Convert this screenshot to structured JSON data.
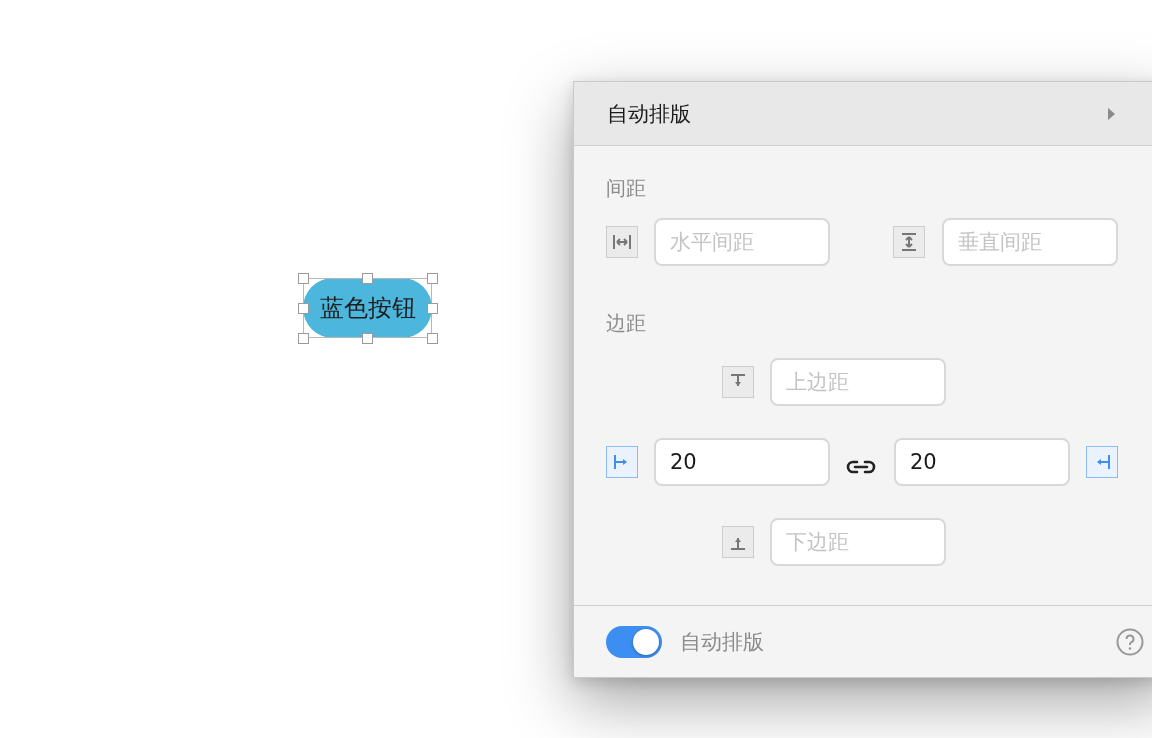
{
  "canvas": {
    "button": {
      "label": "蓝色按钮",
      "selected": true
    }
  },
  "panel": {
    "title": "自动排版",
    "spacing": {
      "label": "间距",
      "horizontal": {
        "placeholder": "水平间距",
        "active": false
      },
      "vertical": {
        "placeholder": "垂直间距",
        "active": false
      }
    },
    "margins": {
      "label": "边距",
      "top": {
        "placeholder": "上边距",
        "active": false
      },
      "left": {
        "value": "20",
        "active": true
      },
      "right": {
        "value": "20",
        "active": true
      },
      "bottom": {
        "placeholder": "下边距",
        "active": false
      }
    },
    "footer": {
      "toggle": {
        "label": "自动排版",
        "on": true
      }
    }
  }
}
